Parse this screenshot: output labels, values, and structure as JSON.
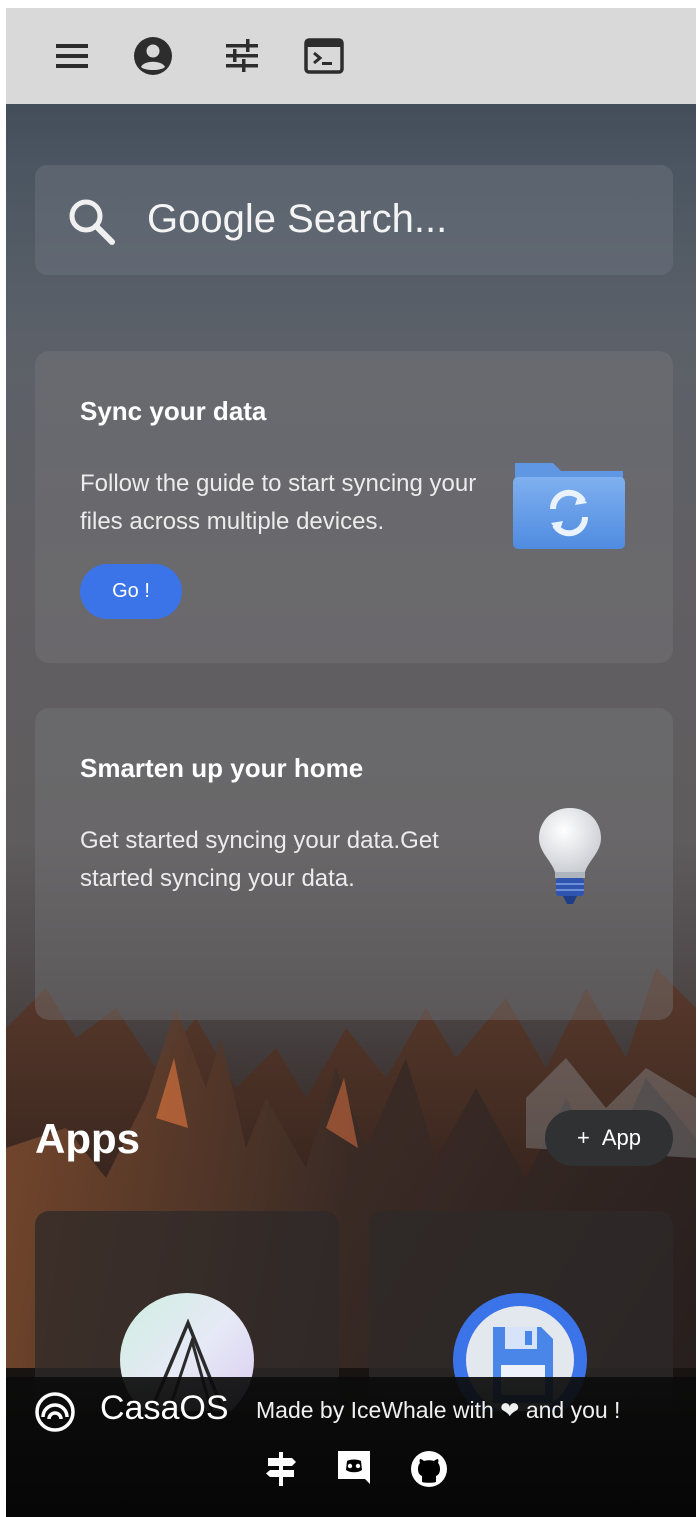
{
  "topbar": {
    "icons": [
      "menu-icon",
      "account-icon",
      "settings-sliders-icon",
      "terminal-icon"
    ],
    "background": "#d9d9d9"
  },
  "search": {
    "placeholder": "Google Search..."
  },
  "cards": [
    {
      "title": "Sync your data",
      "description": "Follow the guide to start syncing your files across multiple devices.",
      "button_label": "Go !",
      "icon": "sync-folder-icon"
    },
    {
      "title": "Smarten up your home",
      "description": "Get started syncing your data.Get started syncing your data.",
      "icon": "lightbulb-icon"
    }
  ],
  "apps": {
    "title": "Apps",
    "add_label": "App",
    "add_icon": "plus-icon",
    "items": [
      {
        "icon": "app-logo-triangle"
      },
      {
        "icon": "app-logo-floppy"
      }
    ]
  },
  "footer": {
    "brand": "CasaOS",
    "made_by": "Made by IceWhale with ❤ and you !",
    "icons": [
      "signpost-icon",
      "discord-icon",
      "github-icon"
    ]
  },
  "colors": {
    "accent": "#3b73e8",
    "add_button": "#2f3133"
  }
}
